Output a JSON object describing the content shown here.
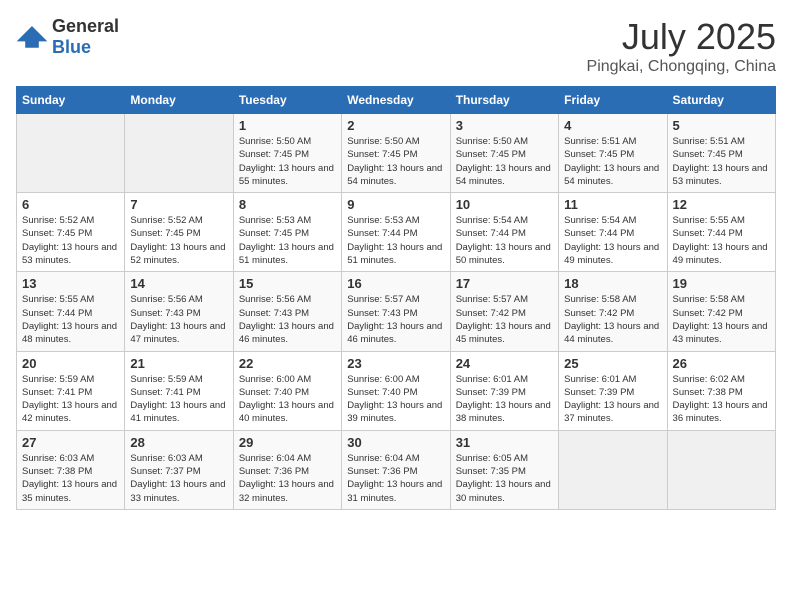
{
  "header": {
    "logo_general": "General",
    "logo_blue": "Blue",
    "title": "July 2025",
    "subtitle": "Pingkai, Chongqing, China"
  },
  "calendar": {
    "weekdays": [
      "Sunday",
      "Monday",
      "Tuesday",
      "Wednesday",
      "Thursday",
      "Friday",
      "Saturday"
    ],
    "weeks": [
      [
        {
          "day": "",
          "sunrise": "",
          "sunset": "",
          "daylight": "",
          "empty": true
        },
        {
          "day": "",
          "sunrise": "",
          "sunset": "",
          "daylight": "",
          "empty": true
        },
        {
          "day": "1",
          "sunrise": "Sunrise: 5:50 AM",
          "sunset": "Sunset: 7:45 PM",
          "daylight": "Daylight: 13 hours and 55 minutes."
        },
        {
          "day": "2",
          "sunrise": "Sunrise: 5:50 AM",
          "sunset": "Sunset: 7:45 PM",
          "daylight": "Daylight: 13 hours and 54 minutes."
        },
        {
          "day": "3",
          "sunrise": "Sunrise: 5:50 AM",
          "sunset": "Sunset: 7:45 PM",
          "daylight": "Daylight: 13 hours and 54 minutes."
        },
        {
          "day": "4",
          "sunrise": "Sunrise: 5:51 AM",
          "sunset": "Sunset: 7:45 PM",
          "daylight": "Daylight: 13 hours and 54 minutes."
        },
        {
          "day": "5",
          "sunrise": "Sunrise: 5:51 AM",
          "sunset": "Sunset: 7:45 PM",
          "daylight": "Daylight: 13 hours and 53 minutes."
        }
      ],
      [
        {
          "day": "6",
          "sunrise": "Sunrise: 5:52 AM",
          "sunset": "Sunset: 7:45 PM",
          "daylight": "Daylight: 13 hours and 53 minutes."
        },
        {
          "day": "7",
          "sunrise": "Sunrise: 5:52 AM",
          "sunset": "Sunset: 7:45 PM",
          "daylight": "Daylight: 13 hours and 52 minutes."
        },
        {
          "day": "8",
          "sunrise": "Sunrise: 5:53 AM",
          "sunset": "Sunset: 7:45 PM",
          "daylight": "Daylight: 13 hours and 51 minutes."
        },
        {
          "day": "9",
          "sunrise": "Sunrise: 5:53 AM",
          "sunset": "Sunset: 7:44 PM",
          "daylight": "Daylight: 13 hours and 51 minutes."
        },
        {
          "day": "10",
          "sunrise": "Sunrise: 5:54 AM",
          "sunset": "Sunset: 7:44 PM",
          "daylight": "Daylight: 13 hours and 50 minutes."
        },
        {
          "day": "11",
          "sunrise": "Sunrise: 5:54 AM",
          "sunset": "Sunset: 7:44 PM",
          "daylight": "Daylight: 13 hours and 49 minutes."
        },
        {
          "day": "12",
          "sunrise": "Sunrise: 5:55 AM",
          "sunset": "Sunset: 7:44 PM",
          "daylight": "Daylight: 13 hours and 49 minutes."
        }
      ],
      [
        {
          "day": "13",
          "sunrise": "Sunrise: 5:55 AM",
          "sunset": "Sunset: 7:44 PM",
          "daylight": "Daylight: 13 hours and 48 minutes."
        },
        {
          "day": "14",
          "sunrise": "Sunrise: 5:56 AM",
          "sunset": "Sunset: 7:43 PM",
          "daylight": "Daylight: 13 hours and 47 minutes."
        },
        {
          "day": "15",
          "sunrise": "Sunrise: 5:56 AM",
          "sunset": "Sunset: 7:43 PM",
          "daylight": "Daylight: 13 hours and 46 minutes."
        },
        {
          "day": "16",
          "sunrise": "Sunrise: 5:57 AM",
          "sunset": "Sunset: 7:43 PM",
          "daylight": "Daylight: 13 hours and 46 minutes."
        },
        {
          "day": "17",
          "sunrise": "Sunrise: 5:57 AM",
          "sunset": "Sunset: 7:42 PM",
          "daylight": "Daylight: 13 hours and 45 minutes."
        },
        {
          "day": "18",
          "sunrise": "Sunrise: 5:58 AM",
          "sunset": "Sunset: 7:42 PM",
          "daylight": "Daylight: 13 hours and 44 minutes."
        },
        {
          "day": "19",
          "sunrise": "Sunrise: 5:58 AM",
          "sunset": "Sunset: 7:42 PM",
          "daylight": "Daylight: 13 hours and 43 minutes."
        }
      ],
      [
        {
          "day": "20",
          "sunrise": "Sunrise: 5:59 AM",
          "sunset": "Sunset: 7:41 PM",
          "daylight": "Daylight: 13 hours and 42 minutes."
        },
        {
          "day": "21",
          "sunrise": "Sunrise: 5:59 AM",
          "sunset": "Sunset: 7:41 PM",
          "daylight": "Daylight: 13 hours and 41 minutes."
        },
        {
          "day": "22",
          "sunrise": "Sunrise: 6:00 AM",
          "sunset": "Sunset: 7:40 PM",
          "daylight": "Daylight: 13 hours and 40 minutes."
        },
        {
          "day": "23",
          "sunrise": "Sunrise: 6:00 AM",
          "sunset": "Sunset: 7:40 PM",
          "daylight": "Daylight: 13 hours and 39 minutes."
        },
        {
          "day": "24",
          "sunrise": "Sunrise: 6:01 AM",
          "sunset": "Sunset: 7:39 PM",
          "daylight": "Daylight: 13 hours and 38 minutes."
        },
        {
          "day": "25",
          "sunrise": "Sunrise: 6:01 AM",
          "sunset": "Sunset: 7:39 PM",
          "daylight": "Daylight: 13 hours and 37 minutes."
        },
        {
          "day": "26",
          "sunrise": "Sunrise: 6:02 AM",
          "sunset": "Sunset: 7:38 PM",
          "daylight": "Daylight: 13 hours and 36 minutes."
        }
      ],
      [
        {
          "day": "27",
          "sunrise": "Sunrise: 6:03 AM",
          "sunset": "Sunset: 7:38 PM",
          "daylight": "Daylight: 13 hours and 35 minutes."
        },
        {
          "day": "28",
          "sunrise": "Sunrise: 6:03 AM",
          "sunset": "Sunset: 7:37 PM",
          "daylight": "Daylight: 13 hours and 33 minutes."
        },
        {
          "day": "29",
          "sunrise": "Sunrise: 6:04 AM",
          "sunset": "Sunset: 7:36 PM",
          "daylight": "Daylight: 13 hours and 32 minutes."
        },
        {
          "day": "30",
          "sunrise": "Sunrise: 6:04 AM",
          "sunset": "Sunset: 7:36 PM",
          "daylight": "Daylight: 13 hours and 31 minutes."
        },
        {
          "day": "31",
          "sunrise": "Sunrise: 6:05 AM",
          "sunset": "Sunset: 7:35 PM",
          "daylight": "Daylight: 13 hours and 30 minutes."
        },
        {
          "day": "",
          "sunrise": "",
          "sunset": "",
          "daylight": "",
          "empty": true
        },
        {
          "day": "",
          "sunrise": "",
          "sunset": "",
          "daylight": "",
          "empty": true
        }
      ]
    ]
  }
}
